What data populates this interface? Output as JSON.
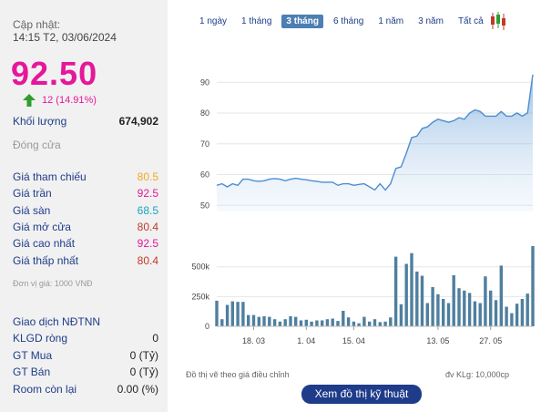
{
  "left": {
    "updated_label": "Cập nhật:",
    "updated_time": "14:15 T2, 03/06/2024",
    "price": "92.50",
    "change": "12 (14.91%)",
    "volume_label": "Khối lượng",
    "volume_value": "674,902",
    "close_label": "Đóng cửa",
    "ref_label": "Giá tham chiếu",
    "ref_value": "80.5",
    "ceil_label": "Giá trần",
    "ceil_value": "92.5",
    "floor_label": "Giá sàn",
    "floor_value": "68.5",
    "open_label": "Giá mở cửa",
    "open_value": "80.4",
    "high_label": "Giá cao nhất",
    "high_value": "92.5",
    "low_label": "Giá thấp nhất",
    "low_value": "80.4",
    "unit_note": "Đơn vị giá: 1000 VNĐ",
    "foreign_title": "Giao dịch NĐTNN",
    "net_label": "KLGD ròng",
    "net_value": "0",
    "buy_label": "GT Mua",
    "buy_value": "0 (Tỷ)",
    "sell_label": "GT Bán",
    "sell_value": "0 (Tỷ)",
    "room_label": "Room còn lại",
    "room_value": "0.00 (%)"
  },
  "tabs": [
    "1 ngày",
    "1 tháng",
    "3 tháng",
    "6 tháng",
    "1 năm",
    "3 năm",
    "Tất cả"
  ],
  "active_tab": 2,
  "colors": {
    "accent": "#e5179b",
    "line": "#4c8ed0",
    "area": "#c9dcf2",
    "bar": "#4f7f9e",
    "nav": "#1f3c8a"
  },
  "chart_data": {
    "type": "line",
    "x_ticks": [
      "18. 03",
      "1. 04",
      "15. 04",
      "13. 05",
      "27. 05"
    ],
    "price_ticks": [
      "90",
      "80",
      "70",
      "60",
      "50"
    ],
    "price_range": [
      48,
      96
    ],
    "volume_ticks": [
      "500k",
      "250k",
      "0"
    ],
    "volume_range": [
      0,
      720000
    ],
    "price": [
      56.5,
      57,
      56,
      57,
      56.5,
      58.5,
      58.5,
      58,
      57.8,
      58,
      58.5,
      58.7,
      58.5,
      58,
      58.5,
      58.8,
      58.5,
      58.3,
      58,
      57.8,
      57.5,
      57.5,
      57.5,
      56.5,
      57,
      57,
      56.5,
      56.8,
      57,
      56,
      55,
      57,
      55,
      57,
      62,
      62.5,
      67,
      72,
      72.5,
      75,
      75.5,
      77,
      78,
      77.5,
      77,
      77.5,
      78.5,
      78,
      80,
      81,
      80.5,
      79,
      79,
      79,
      80.5,
      79,
      79,
      80,
      79,
      80,
      92.5
    ],
    "volume": [
      215000,
      60000,
      180000,
      210000,
      205000,
      205000,
      95000,
      95000,
      80000,
      85000,
      80000,
      60000,
      40000,
      60000,
      85000,
      80000,
      50000,
      55000,
      40000,
      50000,
      50000,
      60000,
      65000,
      45000,
      130000,
      75000,
      40000,
      25000,
      80000,
      40000,
      60000,
      35000,
      40000,
      75000,
      585000,
      185000,
      525000,
      615000,
      460000,
      425000,
      195000,
      330000,
      270000,
      230000,
      195000,
      430000,
      320000,
      300000,
      280000,
      210000,
      195000,
      420000,
      300000,
      220000,
      510000,
      165000,
      110000,
      190000,
      230000,
      275000,
      674902
    ],
    "footnote_left": "Đồ thị vẽ theo giá điều chỉnh",
    "footnote_right": "đv KLg: 10,000cp"
  },
  "button_label": "Xem đồ thị kỹ thuật"
}
